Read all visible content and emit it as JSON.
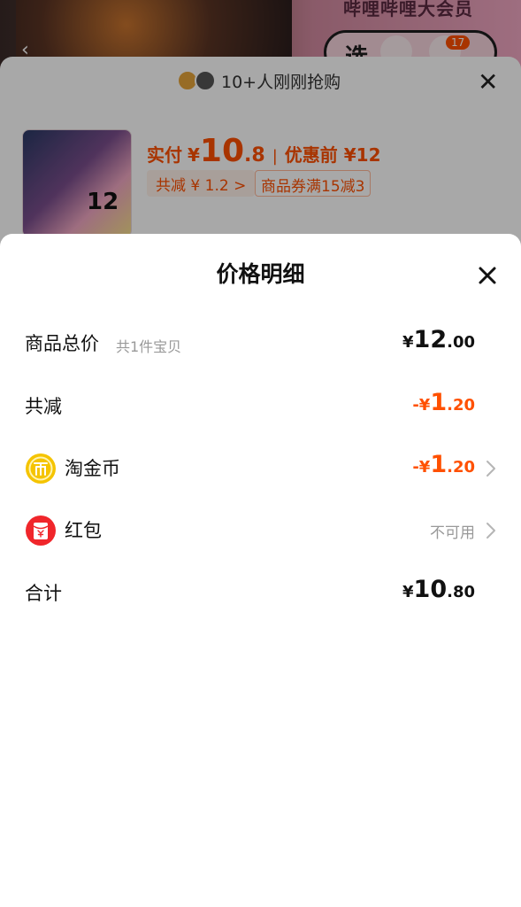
{
  "background": {
    "brand": "哔哩哔哩大会员",
    "pill_text": "选",
    "cart_count": "17",
    "sku": {
      "buyers_text": "10+人刚刚抢购",
      "thumb_number": "12",
      "price_label": "实付",
      "currency": "¥",
      "price_int": "10",
      "price_dec": ".8",
      "separator": "|",
      "original_label": "优惠前 ¥12",
      "discount_tag": "共减 ¥ 1.2 >",
      "coupon_tag": "商品券满15减3"
    }
  },
  "sheet": {
    "title": "价格明细",
    "rows": [
      {
        "label": "商品总价",
        "sub": "共1件宝贝",
        "cur": "¥",
        "int": "12",
        "dec": ".00",
        "color": "#111111"
      },
      {
        "label": "共减",
        "cur": "-¥",
        "int": "1",
        "dec": ".20",
        "color": "#ff5000"
      },
      {
        "label": "淘金币",
        "icon": "gold-coin-icon",
        "cur": "-¥",
        "int": "1",
        "dec": ".20",
        "color": "#ff5000",
        "chevron": true
      },
      {
        "label": "红包",
        "icon": "red-packet-icon",
        "status": "不可用",
        "chevron": true
      },
      {
        "label": "合计",
        "cur": "¥",
        "int": "10",
        "dec": ".80",
        "color": "#111111"
      }
    ]
  },
  "colors": {
    "accent": "#ff5000",
    "text": "#111111",
    "muted": "#999999",
    "coin": "#f5c400",
    "red_packet": "#f0262b"
  }
}
